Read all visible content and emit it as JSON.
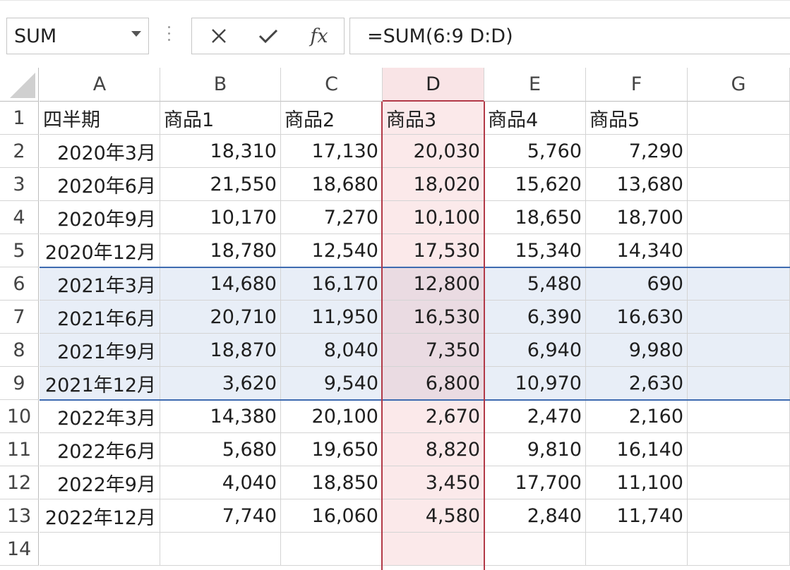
{
  "formula_bar": {
    "name_box": "SUM",
    "cancel_icon": "close-icon",
    "enter_icon": "check-icon",
    "function_icon": "fx-icon",
    "function_label": "fx",
    "formula": "=SUM(6:9 D:D)"
  },
  "colors": {
    "row_selection": "#3e6bb0",
    "column_selection": "#b23a48",
    "row_fill": "#e8eef7",
    "column_fill": "#fbe9ea"
  },
  "columns": [
    "A",
    "B",
    "C",
    "D",
    "E",
    "F",
    "G"
  ],
  "rows": [
    "1",
    "2",
    "3",
    "4",
    "5",
    "6",
    "7",
    "8",
    "9",
    "10",
    "11",
    "12",
    "13",
    "14"
  ],
  "headers": [
    "四半期",
    "商品1",
    "商品2",
    "商品3",
    "商品4",
    "商品5"
  ],
  "data": [
    [
      "2020年3月",
      "18,310",
      "17,130",
      "20,030",
      "5,760",
      "7,290"
    ],
    [
      "2020年6月",
      "21,550",
      "18,680",
      "18,020",
      "15,620",
      "13,680"
    ],
    [
      "2020年9月",
      "10,170",
      "7,270",
      "10,100",
      "18,650",
      "18,700"
    ],
    [
      "2020年12月",
      "18,780",
      "12,540",
      "17,530",
      "15,340",
      "14,340"
    ],
    [
      "2021年3月",
      "14,680",
      "16,170",
      "12,800",
      "5,480",
      "690"
    ],
    [
      "2021年6月",
      "20,710",
      "11,950",
      "16,530",
      "6,390",
      "16,630"
    ],
    [
      "2021年9月",
      "18,870",
      "8,040",
      "7,350",
      "6,940",
      "9,980"
    ],
    [
      "2021年12月",
      "3,620",
      "9,540",
      "6,800",
      "10,970",
      "2,630"
    ],
    [
      "2022年3月",
      "14,380",
      "20,100",
      "2,670",
      "2,470",
      "2,160"
    ],
    [
      "2022年6月",
      "5,680",
      "19,650",
      "8,820",
      "9,810",
      "16,140"
    ],
    [
      "2022年9月",
      "4,040",
      "18,850",
      "3,450",
      "17,700",
      "11,100"
    ],
    [
      "2022年12月",
      "7,740",
      "16,060",
      "4,580",
      "2,840",
      "11,740"
    ]
  ],
  "selection": {
    "rows": [
      "6",
      "9"
    ],
    "column": "D"
  }
}
